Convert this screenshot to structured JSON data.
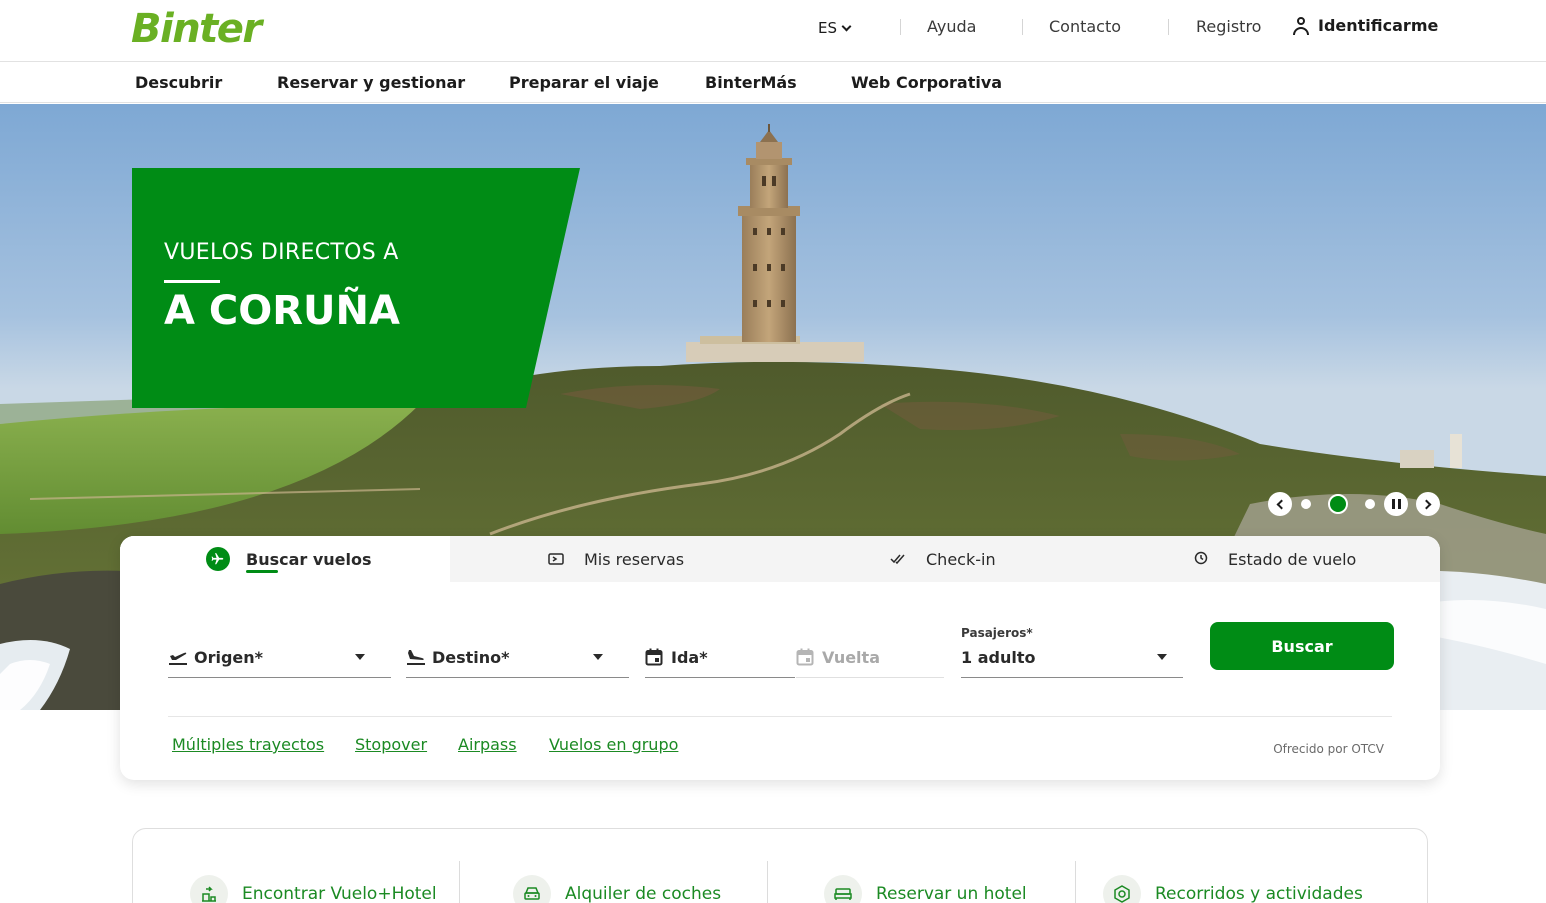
{
  "header": {
    "logo": "Binter",
    "language": "ES",
    "links": [
      "Ayuda",
      "Contacto",
      "Registro"
    ],
    "login": "Identificarme"
  },
  "nav": {
    "items": [
      "Descubrir",
      "Reservar y gestionar",
      "Preparar el viaje",
      "BinterMás",
      "Web Corporativa"
    ]
  },
  "hero": {
    "promo_small": "VUELOS DIRECTOS A",
    "promo_big": "A CORUÑA",
    "carousel": {
      "slides": 3,
      "active_slide": 2
    }
  },
  "search": {
    "tabs": [
      {
        "label": "Buscar vuelos",
        "icon": "plane-icon"
      },
      {
        "label": "Mis reservas",
        "icon": "ticket-icon"
      },
      {
        "label": "Check-in",
        "icon": "double-check-icon"
      },
      {
        "label": "Estado de vuelo",
        "icon": "clock-icon"
      }
    ],
    "origin": "Origen*",
    "destination": "Destino*",
    "departure": "Ida*",
    "return": "Vuelta",
    "passengers_label": "Pasajeros*",
    "passengers_value": "1 adulto",
    "submit": "Buscar",
    "links": [
      "Múltiples trayectos",
      "Stopover",
      "Airpass",
      "Vuelos en grupo"
    ],
    "offered_by": "Ofrecido por OTCV"
  },
  "services": {
    "items": [
      "Encontrar Vuelo+Hotel",
      "Alquiler de coches",
      "Reservar un hotel",
      "Recorridos y actividades"
    ]
  },
  "colors": {
    "brand_green": "#008c15",
    "logo_green": "#6ab023",
    "link_green": "#1b8a23"
  }
}
